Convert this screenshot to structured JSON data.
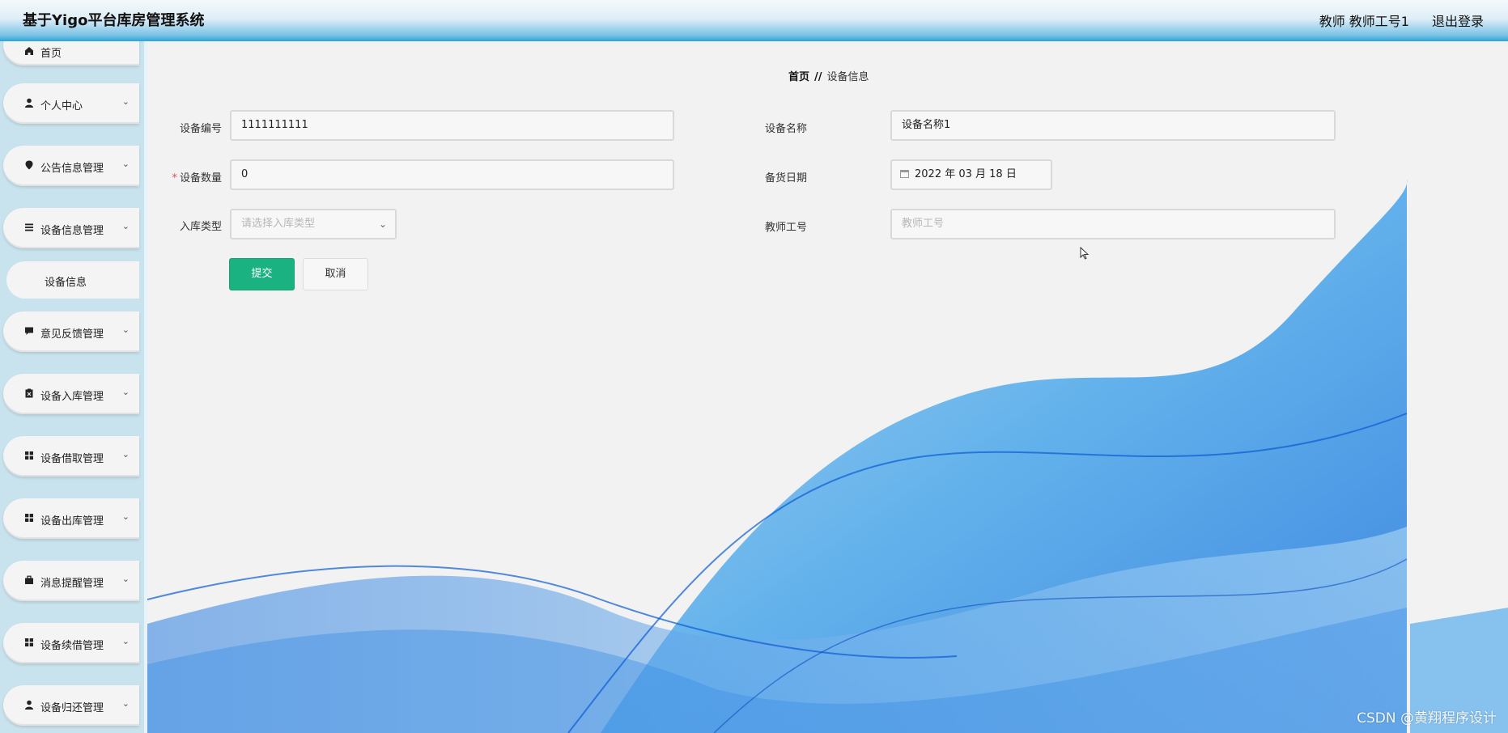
{
  "header": {
    "title": "基于Yigo平台库房管理系统",
    "user": "教师 教师工号1",
    "logout": "退出登录"
  },
  "sidebar": {
    "items": [
      {
        "label": "首页",
        "icon": "home-icon"
      },
      {
        "label": "个人中心",
        "icon": "user-icon"
      },
      {
        "label": "公告信息管理",
        "icon": "location-pin-icon"
      },
      {
        "label": "设备信息管理",
        "icon": "list-icon"
      },
      {
        "label": "设备信息",
        "icon": ""
      },
      {
        "label": "意见反馈管理",
        "icon": "comment-icon"
      },
      {
        "label": "设备入库管理",
        "icon": "clipboard-icon"
      },
      {
        "label": "设备借取管理",
        "icon": "grid-icon"
      },
      {
        "label": "设备出库管理",
        "icon": "grid-icon"
      },
      {
        "label": "消息提醒管理",
        "icon": "briefcase-icon"
      },
      {
        "label": "设备续借管理",
        "icon": "grid-icon"
      },
      {
        "label": "设备归还管理",
        "icon": "user-icon"
      }
    ]
  },
  "breadcrumb": {
    "home": "首页",
    "sep": "//",
    "current": "设备信息"
  },
  "form": {
    "device_no": {
      "label": "设备编号",
      "value": "1111111111"
    },
    "device_name": {
      "label": "设备名称",
      "value": "设备名称1"
    },
    "quantity": {
      "label": "设备数量",
      "value": "0",
      "required": "*"
    },
    "stock_date": {
      "label": "备货日期",
      "value": "2022 年 03 月 18 日"
    },
    "storage_type": {
      "label": "入库类型",
      "placeholder": "请选择入库类型"
    },
    "teacher_no": {
      "label": "教师工号",
      "placeholder": "教师工号"
    }
  },
  "buttons": {
    "submit": "提交",
    "cancel": "取消"
  },
  "watermark": "CSDN @黄翔程序设计",
  "colors": {
    "primary": "#1ab280",
    "header_accent": "#2aa3d9",
    "sidebar_bg": "#c9e3ee"
  }
}
